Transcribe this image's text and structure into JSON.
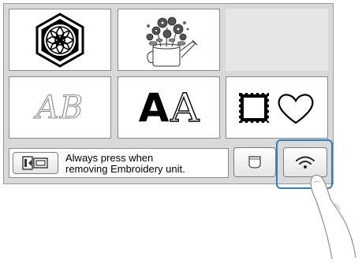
{
  "screen": {
    "tiles": [
      {
        "name": "tile-pattern-hexagon",
        "icon": "hexagon-floral-emblem-icon"
      },
      {
        "name": "tile-pattern-flower-watering-can",
        "icon": "flower-watering-can-icon"
      },
      {
        "name": "tile-empty",
        "icon": ""
      },
      {
        "name": "tile-script-alphabet",
        "icon": "script-ab-icon",
        "text": "AB"
      },
      {
        "name": "tile-font-alphabet",
        "icon": "font-aa-icon",
        "text_bold": "A",
        "text_outline": "A"
      },
      {
        "name": "tile-frame-shapes",
        "icon": "frame-square-heart-icon"
      }
    ]
  },
  "bottom_bar": {
    "remove_unit_button_icon": "embroidery-unit-remove-icon",
    "message_line1": "Always press when",
    "message_line2": "removing Embroidery unit.",
    "pocket_button_icon": "pocket-icon",
    "wireless_button_icon": "wifi-icon"
  },
  "colors": {
    "highlight": "#2f7fb8",
    "screen_bg": "#d9d9d9"
  }
}
